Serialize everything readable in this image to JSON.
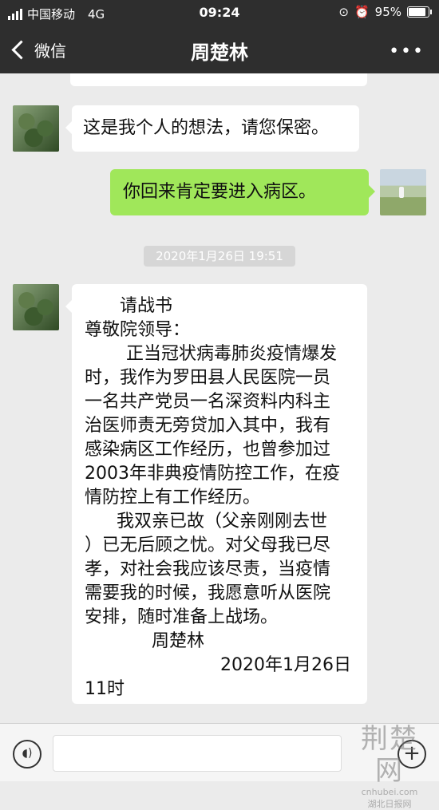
{
  "status_bar": {
    "carrier": "中国移动",
    "network": "4G",
    "time": "09:24",
    "battery": "95%",
    "battery_level": 0.95
  },
  "nav": {
    "back_label": "微信",
    "title": "周楚林",
    "more": "•••"
  },
  "messages": {
    "m1_text": "这是我个人的想法，请您保密。",
    "m2_text": "你回来肯定要进入病区。",
    "timestamp": "2020年1月26日  19:51",
    "letter_lines": [
      "请战书",
      "尊敬院领导：",
      "正当冠状病毒肺炎疫情爆发",
      "时，我作为罗田县人民医院一员",
      "一名共产党员一名深资料内科主",
      "治医师责无旁贷加入其中，我有",
      "感染病区工作经历，也曾参加过",
      "2003年非典疫情防控工作，在疫",
      "情防控上有工作经历。",
      "我双亲已故（父亲刚刚去世",
      "）已无后顾之忧。对父母我已尽",
      "孝，对社会我应该尽责，当疫情",
      "需要我的时候，我愿意听从医院",
      "安排，随时准备上战场。",
      "周楚林",
      "2020年1月26日",
      "11时"
    ]
  },
  "input_bar": {
    "voice_icon": "speaker-icon",
    "plus_icon": "plus-icon"
  },
  "watermark": {
    "brand": "荆楚网",
    "site": "cnhubei.com",
    "sub": "湖北日报网"
  }
}
